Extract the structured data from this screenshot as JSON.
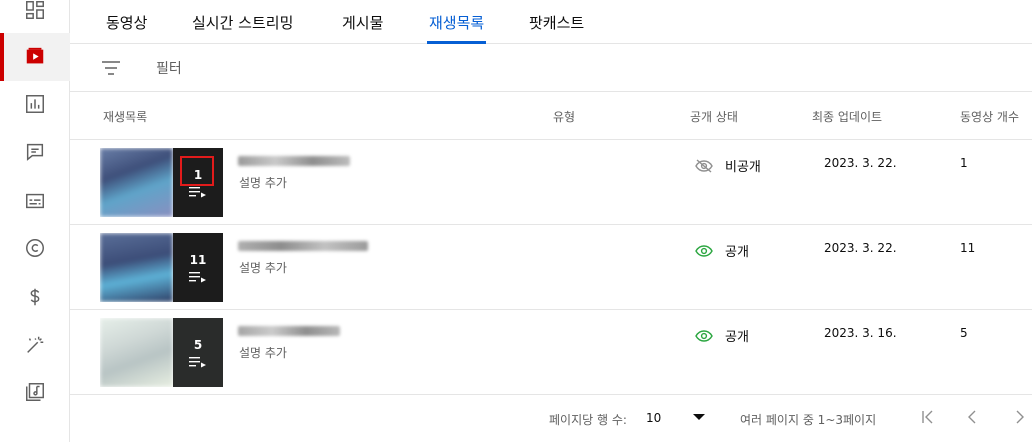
{
  "tabs": [
    {
      "label": "동영상"
    },
    {
      "label": "실시간 스트리밍"
    },
    {
      "label": "게시물"
    },
    {
      "label": "재생목록"
    },
    {
      "label": "팟캐스트"
    }
  ],
  "active_tab": "재생목록",
  "filter": {
    "placeholder": "필터"
  },
  "sidebar": [
    {
      "icon": "dashboard-icon"
    },
    {
      "icon": "content-icon",
      "active": true
    },
    {
      "icon": "analytics-icon"
    },
    {
      "icon": "comments-icon"
    },
    {
      "icon": "subtitles-icon"
    },
    {
      "icon": "copyright-icon"
    },
    {
      "icon": "earn-icon"
    },
    {
      "icon": "customization-icon"
    },
    {
      "icon": "audio-library-icon"
    }
  ],
  "table": {
    "headers": {
      "playlist": "재생목록",
      "type": "유형",
      "visibility": "공개 상태",
      "updated": "최종 업데이트",
      "count": "동영상 개수"
    },
    "rows": [
      {
        "video_count_badge": "1",
        "description": "설명 추가",
        "visibility": "비공개",
        "visibility_icon": "eye-off-icon",
        "updated": "2023. 3. 22.",
        "count": "1"
      },
      {
        "video_count_badge": "11",
        "description": "설명 추가",
        "visibility": "공개",
        "visibility_icon": "eye-icon",
        "updated": "2023. 3. 22.",
        "count": "11"
      },
      {
        "video_count_badge": "5",
        "description": "설명 추가",
        "visibility": "공개",
        "visibility_icon": "eye-icon",
        "updated": "2023. 3. 16.",
        "count": "5"
      }
    ]
  },
  "footer": {
    "rows_per_page_label": "페이지당 행 수:",
    "rows_per_page": "10",
    "range": "여러 페이지 중 1~3페이지"
  },
  "colors": {
    "accent": "#065fd4",
    "active_bar": "#cc0000",
    "public_eye": "#2ba640",
    "highlight": "#e21b1b"
  }
}
